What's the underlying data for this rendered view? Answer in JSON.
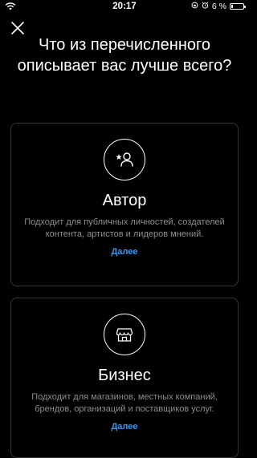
{
  "status_bar": {
    "time": "20:17",
    "battery_percent": "6 %",
    "battery_level": 0.06
  },
  "header": {
    "close_icon": "close-icon",
    "title": "Что из перечисленного описывает вас лучше всего?"
  },
  "options": [
    {
      "icon": "creator-star-person-icon",
      "title": "Автор",
      "description": "Подходит для публичных личностей, создателей контента, артистов и лидеров мнений.",
      "link": "Далее"
    },
    {
      "icon": "store-icon",
      "title": "Бизнес",
      "description": "Подходит для магазинов, местных компаний, брендов, организаций и поставщиков услуг.",
      "link": "Далее"
    }
  ],
  "colors": {
    "background": "#000000",
    "card_border": "#363636",
    "secondary_text": "#8e8e8e",
    "link": "#3897f0"
  }
}
